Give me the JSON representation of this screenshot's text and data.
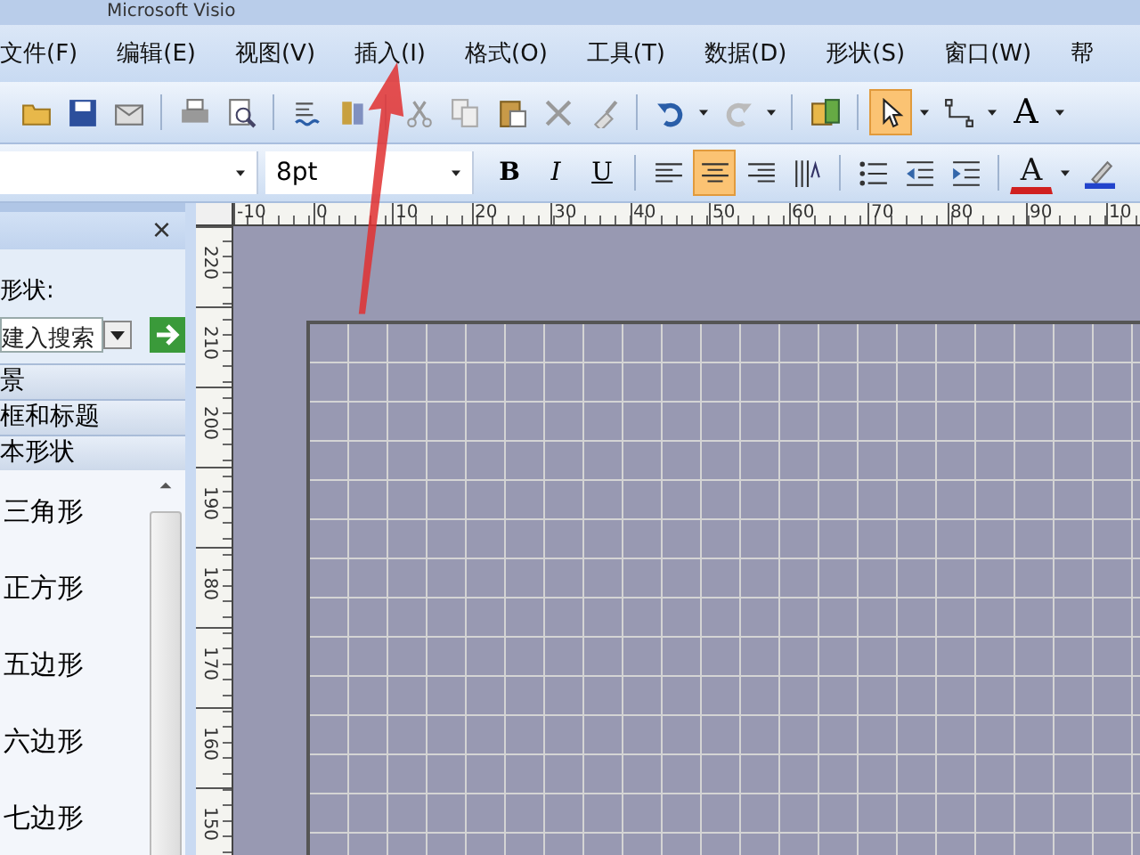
{
  "window": {
    "title": "Microsoft Visio"
  },
  "menu": [
    "文件(F)",
    "编辑(E)",
    "视图(V)",
    "插入(I)",
    "格式(O)",
    "工具(T)",
    "数据(D)",
    "形状(S)",
    "窗口(W)",
    "帮"
  ],
  "toolbar": [
    {
      "kind": "open",
      "selected": false
    },
    {
      "kind": "save",
      "selected": false
    },
    {
      "kind": "permission",
      "selected": false
    },
    {
      "kind": "sep"
    },
    {
      "kind": "print",
      "selected": false
    },
    {
      "kind": "preview",
      "selected": false
    },
    {
      "kind": "sep"
    },
    {
      "kind": "spelling",
      "selected": false
    },
    {
      "kind": "research",
      "selected": false
    },
    {
      "kind": "sep"
    },
    {
      "kind": "cut",
      "selected": false
    },
    {
      "kind": "copy",
      "selected": false
    },
    {
      "kind": "paste",
      "selected": false
    },
    {
      "kind": "delete",
      "selected": false
    },
    {
      "kind": "painter",
      "selected": false
    },
    {
      "kind": "sep"
    },
    {
      "kind": "undo",
      "selected": false
    },
    {
      "kind": "caret"
    },
    {
      "kind": "redo",
      "selected": false
    },
    {
      "kind": "caret"
    },
    {
      "kind": "sep"
    },
    {
      "kind": "shapes",
      "selected": false
    },
    {
      "kind": "sep"
    },
    {
      "kind": "pointer",
      "selected": true
    },
    {
      "kind": "caret"
    },
    {
      "kind": "connector",
      "selected": false
    },
    {
      "kind": "caret"
    },
    {
      "kind": "text",
      "label": "A",
      "selected": false
    },
    {
      "kind": "caret"
    }
  ],
  "format_bar": {
    "size": {
      "value": "8pt"
    },
    "buttons": [
      {
        "kind": "text",
        "label": "B",
        "selected": false
      },
      {
        "kind": "text",
        "label": "I",
        "selected": false
      },
      {
        "kind": "text",
        "label": "U",
        "selected": false
      },
      {
        "kind": "sep"
      },
      {
        "kind": "align-left",
        "selected": false
      },
      {
        "kind": "align-center",
        "selected": true
      },
      {
        "kind": "align-right",
        "selected": false
      },
      {
        "kind": "valign",
        "selected": false
      },
      {
        "kind": "sep"
      },
      {
        "kind": "bullets",
        "selected": false
      },
      {
        "kind": "outdent",
        "selected": false
      },
      {
        "kind": "indent",
        "selected": false
      },
      {
        "kind": "sep"
      },
      {
        "kind": "fontcolor",
        "label": "A",
        "selected": false
      },
      {
        "kind": "caret"
      },
      {
        "kind": "linecolor",
        "selected": false
      }
    ]
  },
  "shapes_pane": {
    "close": "×",
    "search_label": "形状:",
    "search_placeholder": "建入搜索",
    "stencils": [
      "景",
      "框和标题",
      "本形状"
    ],
    "items": [
      "三角形",
      "正方形",
      "五边形",
      "六边形",
      "七边形"
    ]
  },
  "ruler": {
    "horizontal": [
      "-10",
      "0",
      "10",
      "20",
      "30",
      "40",
      "50",
      "60",
      "70",
      "80",
      "90",
      "10"
    ],
    "vertical": [
      "220",
      "210",
      "200",
      "190",
      "180",
      "170",
      "160",
      "150"
    ]
  }
}
